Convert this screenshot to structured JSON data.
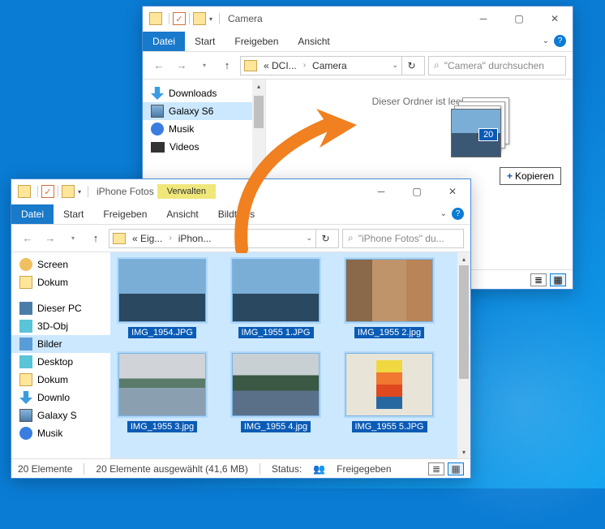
{
  "win1": {
    "title": "Camera",
    "tabs": {
      "file": "Datei",
      "start": "Start",
      "share": "Freigeben",
      "view": "Ansicht"
    },
    "crumbs": {
      "a": "« DCI...",
      "b": "Camera"
    },
    "search_placeholder": "\"Camera\" durchsuchen",
    "tree": {
      "downloads": "Downloads",
      "galaxy": "Galaxy S6",
      "music": "Musik",
      "videos": "Videos"
    },
    "empty": "Dieser Ordner ist leer.",
    "drag_count": "20",
    "copy_label": "Kopieren"
  },
  "win2": {
    "title": "iPhone Fotos",
    "manage": "Verwalten",
    "tabs": {
      "file": "Datei",
      "start": "Start",
      "share": "Freigeben",
      "view": "Ansicht",
      "tools": "Bildtools"
    },
    "crumbs": {
      "a": "« Eig...",
      "b": "iPhon..."
    },
    "search_placeholder": "\"iPhone Fotos\" du...",
    "tree": {
      "screen": "Screen​",
      "dokum": "Dokum​",
      "pc": "Dieser PC",
      "obj": "3D-Obj​",
      "bilder": "Bilder",
      "desktop": "Desktop",
      "dokum2": "Dokum​",
      "downlo": "Downlo​",
      "galaxy": "Galaxy S​",
      "musik": "Musik"
    },
    "files": {
      "f1": "IMG_1954.JPG",
      "f2": "IMG_1955 1.JPG",
      "f3": "IMG_1955 2.jpg",
      "f4": "IMG_1955 3.jpg",
      "f5": "IMG_1955 4.jpg",
      "f6": "IMG_1955 5.JPG"
    },
    "status": {
      "count": "20 Elemente",
      "selected": "20 Elemente ausgewählt (41,6 MB)",
      "status_label": "Status:",
      "status_value": "Freigegeben"
    }
  }
}
